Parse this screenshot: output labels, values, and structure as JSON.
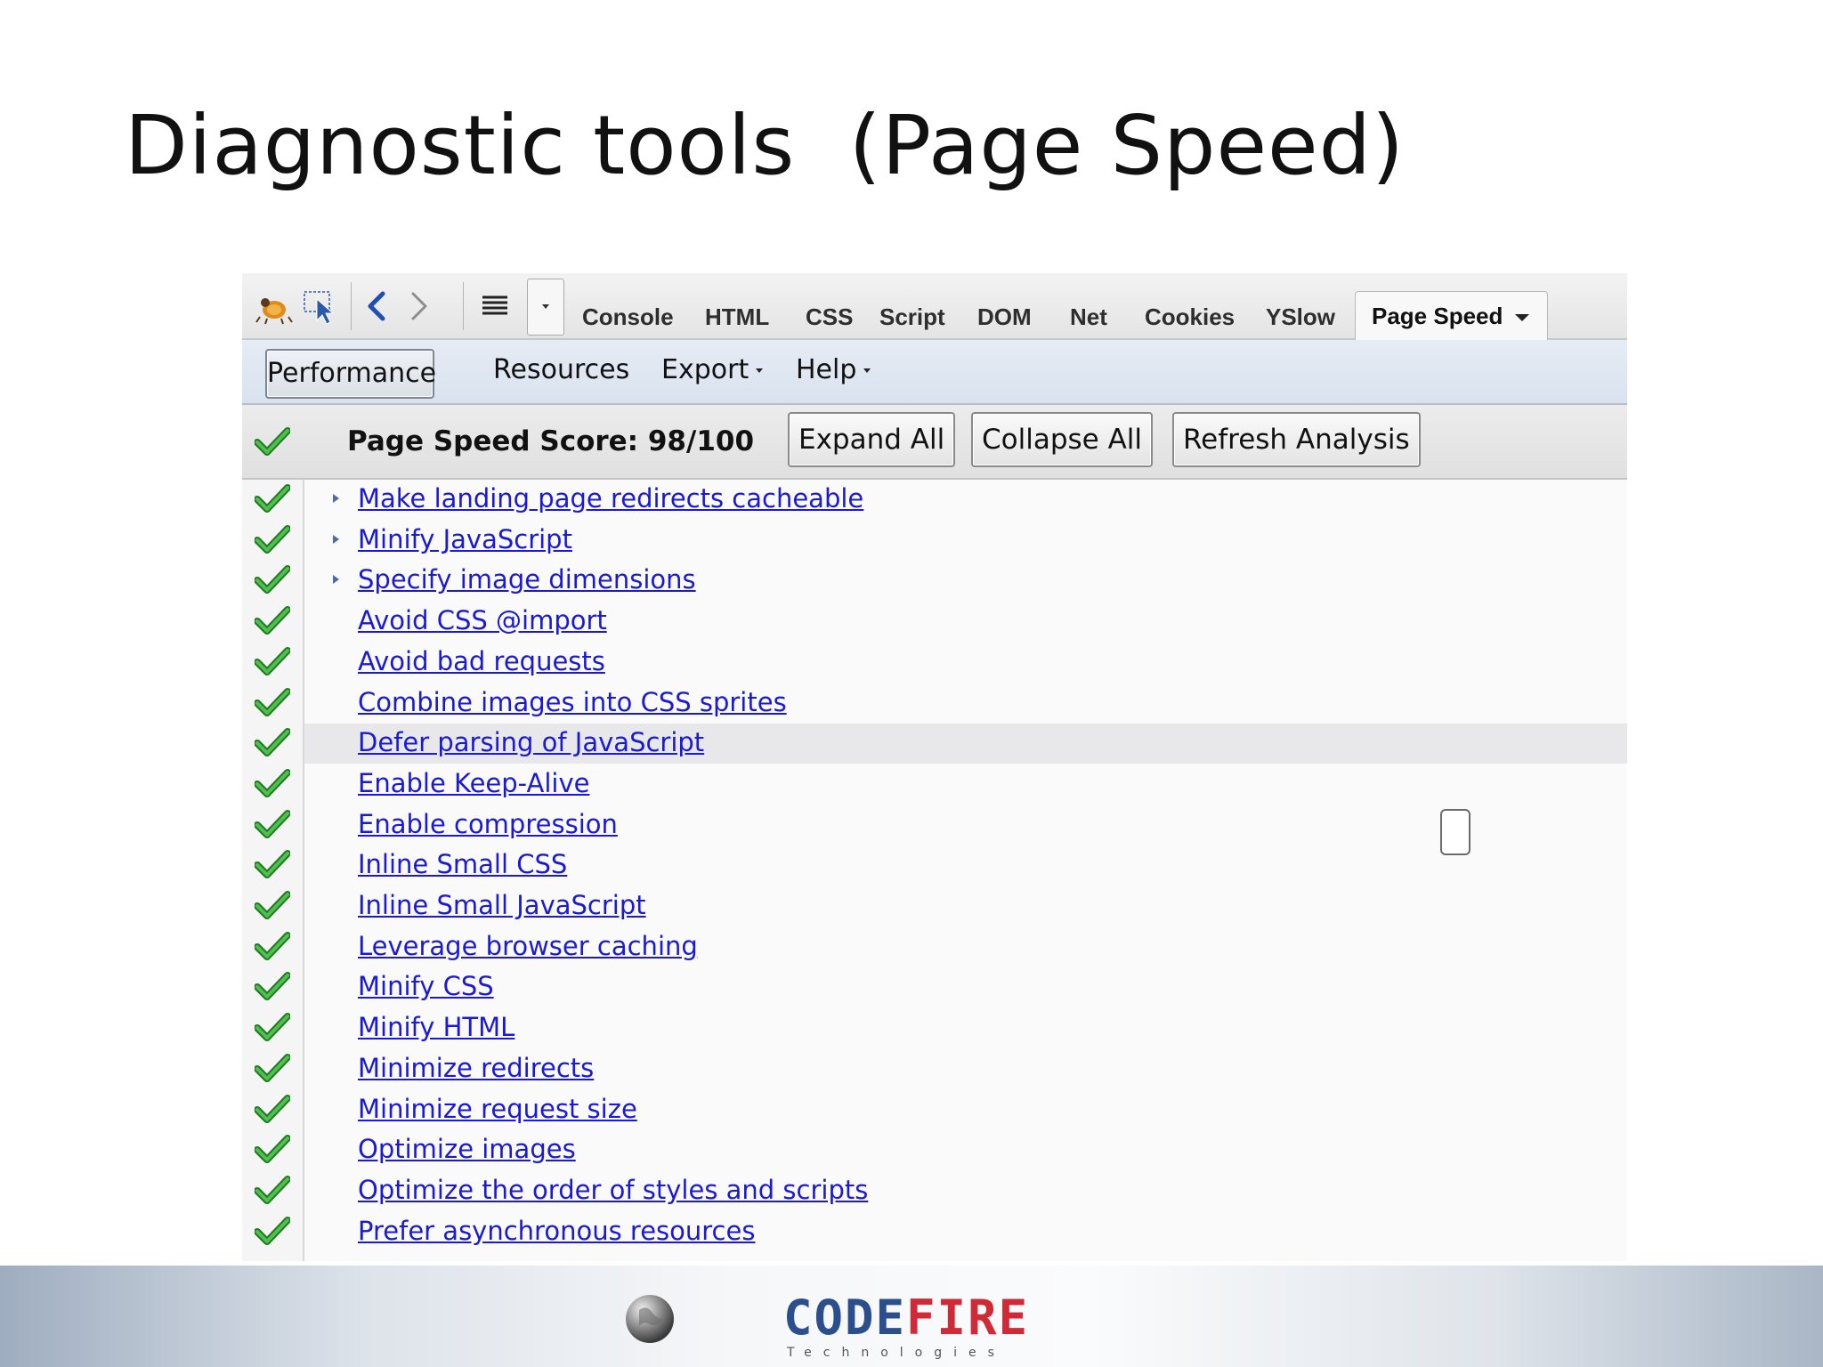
{
  "slide": {
    "title": "Diagnostic tools  (Page Speed)"
  },
  "firebug": {
    "tabs": [
      "Console",
      "HTML",
      "CSS",
      "Script",
      "DOM",
      "Net",
      "Cookies",
      "YSlow"
    ],
    "active_tab": "Page Speed",
    "icons": [
      "firebug-icon",
      "inspect-icon",
      "back-icon",
      "forward-icon",
      "list-icon",
      "dropdown-icon"
    ]
  },
  "pagespeed": {
    "menu": {
      "performance": "Performance",
      "resources": "Resources",
      "export": "Export",
      "help": "Help"
    },
    "score_label": "Page Speed Score: 98/100",
    "buttons": {
      "expand": "Expand All",
      "collapse": "Collapse All",
      "refresh": "Refresh Analysis"
    },
    "rules": [
      "Make landing page redirects cacheable",
      "Minify JavaScript",
      "Specify image dimensions",
      "Avoid CSS @import",
      "Avoid bad requests",
      "Combine images into CSS sprites",
      "Defer parsing of JavaScript",
      "Enable Keep-Alive",
      "Enable compression",
      "Inline Small CSS",
      "Inline Small JavaScript",
      "Leverage browser caching",
      "Minify CSS",
      "Minify HTML",
      "Minimize redirects",
      "Minimize request size",
      "Optimize images",
      "Optimize the order of styles and scripts",
      "Prefer asynchronous resources"
    ],
    "status_color": "#2f9a2f",
    "link_color": "#1a1ad6"
  },
  "footer": {
    "logo_main": "CODE",
    "logo_accent": "FIRE",
    "logo_sub": "Technologies"
  }
}
